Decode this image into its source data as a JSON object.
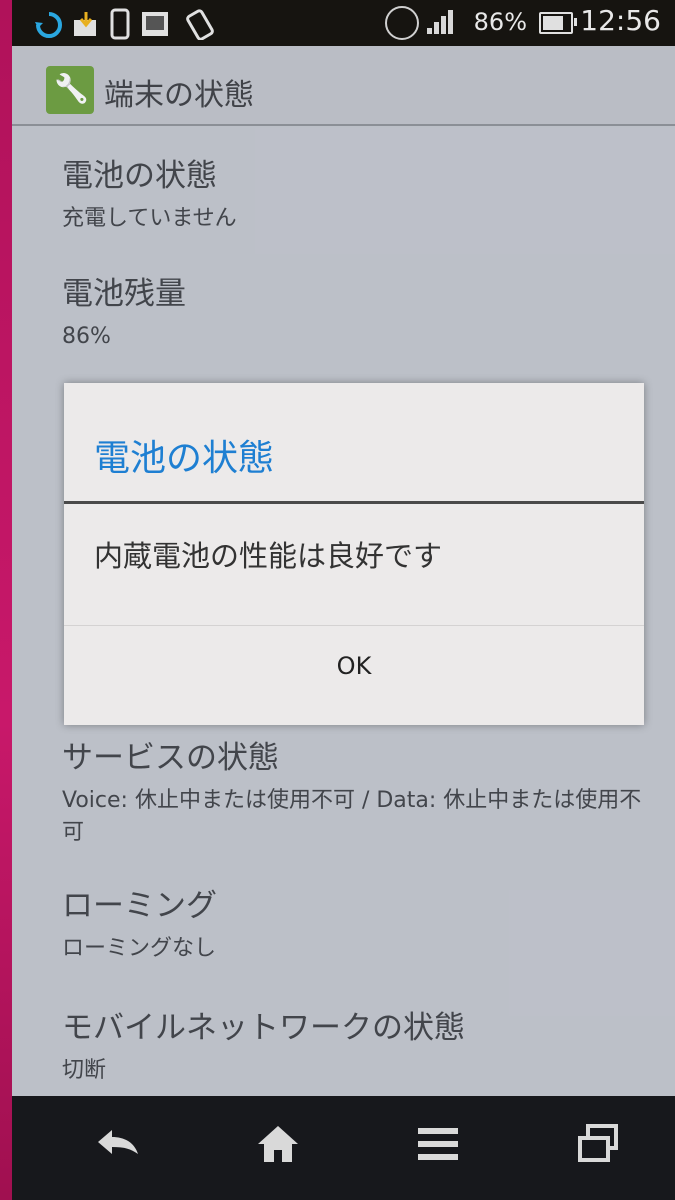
{
  "status_bar": {
    "battery_percent": "86%",
    "time": "12:56",
    "icons": [
      "sync-icon",
      "download-icon",
      "phone-icon",
      "gallery-icon",
      "rotate-icon",
      "nfc-icon",
      "signal-icon",
      "battery-icon"
    ]
  },
  "action_bar": {
    "title": "端末の状態",
    "icon": "wrench-icon"
  },
  "list": {
    "battery_status": {
      "title": "電池の状態",
      "summary": "充電していません"
    },
    "battery_level": {
      "title": "電池残量",
      "summary": "86%"
    },
    "service_status": {
      "title": "サービスの状態",
      "summary": "Voice: 休止中または使用不可 / Data: 休止中または使用不可"
    },
    "roaming": {
      "title": "ローミング",
      "summary": "ローミングなし"
    },
    "mobile_network": {
      "title": "モバイルネットワークの状態",
      "summary": "切断"
    }
  },
  "dialog": {
    "title": "電池の状態",
    "message": "内蔵電池の性能は良好です",
    "ok_label": "OK"
  },
  "nav_bar": {
    "buttons": [
      "back-icon",
      "home-icon",
      "menu-icon",
      "recent-apps-icon"
    ]
  },
  "colors": {
    "accent": "#1e7fd2",
    "screen_background": "#c6c9d1",
    "status_bar": "#161410",
    "nav_bar": "#17181c"
  }
}
